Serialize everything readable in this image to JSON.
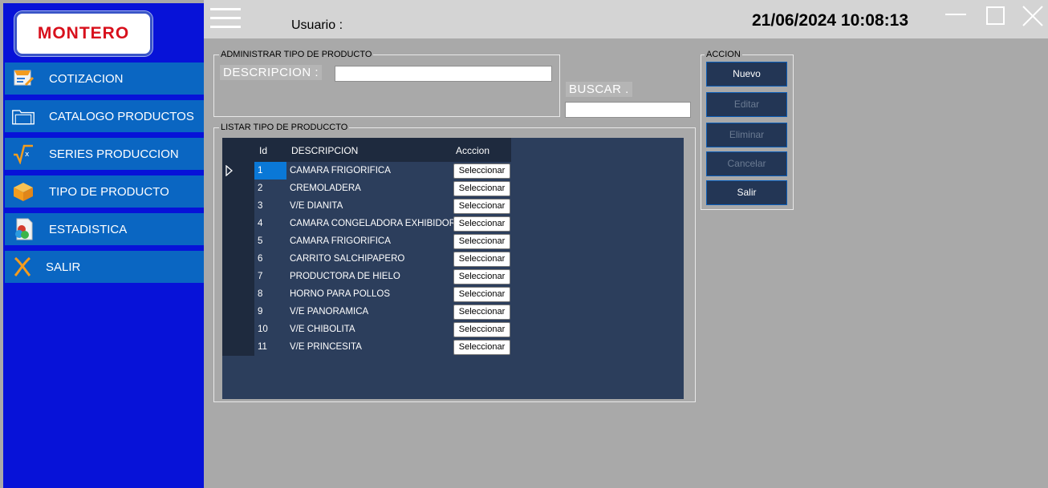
{
  "brand": {
    "logo_text": "MONTERO"
  },
  "sidebar": {
    "items": [
      {
        "label": "COTIZACION",
        "icon": "quote-icon"
      },
      {
        "label": "CATALOGO PRODUCTOS",
        "icon": "folder-icon"
      },
      {
        "label": "SERIES PRODUCCION",
        "icon": "formula-icon"
      },
      {
        "label": "TIPO DE PRODUCTO",
        "icon": "box-icon"
      },
      {
        "label": "ESTADISTICA",
        "icon": "chart-document-icon"
      },
      {
        "label": "SALIR",
        "icon": "exit-icon"
      }
    ]
  },
  "header": {
    "user_label": "Usuario :",
    "datetime": "21/06/2024 10:08:13",
    "controls": [
      "minimize-icon",
      "maximize-icon",
      "close-icon"
    ]
  },
  "admin_group": {
    "title": "ADMINISTRAR TIPO DE PRODUCTO",
    "description_label": "DESCRIPCION :",
    "description_value": ""
  },
  "search": {
    "label": "BUSCAR .",
    "value": ""
  },
  "list_group": {
    "title": "LISTAR TIPO DE PRODUCCTO",
    "columns": [
      "Id",
      "DESCRIPCION",
      "Acccion"
    ],
    "button_label": "Seleccionar",
    "rows": [
      {
        "id": "1",
        "descripcion": "CAMARA FRIGORIFICA"
      },
      {
        "id": "2",
        "descripcion": "CREMOLADERA"
      },
      {
        "id": "3",
        "descripcion": "V/E DIANITA"
      },
      {
        "id": "4",
        "descripcion": "CAMARA CONGELADORA EXHIBIDORA"
      },
      {
        "id": "5",
        "descripcion": "CAMARA FRIGORIFICA"
      },
      {
        "id": "6",
        "descripcion": "CARRITO SALCHIPAPERO"
      },
      {
        "id": "7",
        "descripcion": "PRODUCTORA DE HIELO"
      },
      {
        "id": "8",
        "descripcion": "HORNO PARA POLLOS"
      },
      {
        "id": "9",
        "descripcion": "V/E PANORAMICA"
      },
      {
        "id": "10",
        "descripcion": "V/E CHIBOLITA"
      },
      {
        "id": "11",
        "descripcion": "V/E PRINCESITA"
      }
    ]
  },
  "actions": {
    "title": "ACCION",
    "buttons": [
      {
        "label": "Nuevo",
        "enabled": true
      },
      {
        "label": "Editar",
        "enabled": false
      },
      {
        "label": "Eliminar",
        "enabled": false
      },
      {
        "label": "Cancelar",
        "enabled": false
      },
      {
        "label": "Salir",
        "enabled": true
      }
    ]
  },
  "colors": {
    "sidebar_bg": "#0712d8",
    "nav_item_bg": "#0a66c2",
    "grid_bg": "#2c3e5c",
    "logo_red": "#d8101c",
    "content_bg": "#a9a9a9"
  }
}
